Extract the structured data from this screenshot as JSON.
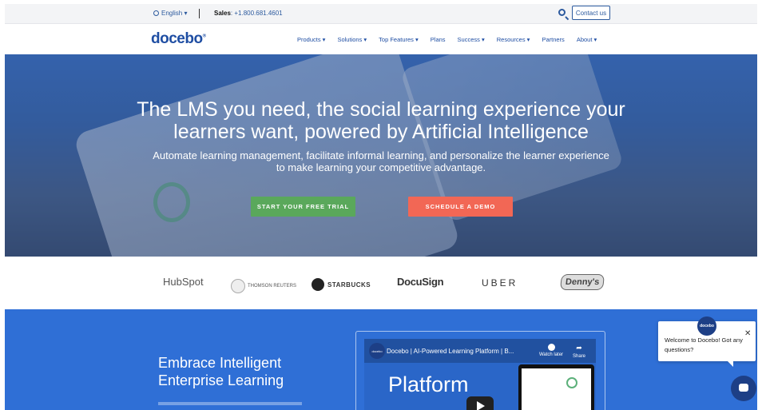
{
  "topbar": {
    "language": "English ▾",
    "sales_label": "Sales",
    "sales_phone": ": +1.800.681.4601",
    "contact_label": "Contact us"
  },
  "nav": {
    "logo": "docebo",
    "items": [
      {
        "label": "Products ▾"
      },
      {
        "label": "Solutions ▾"
      },
      {
        "label": "Top Features ▾"
      },
      {
        "label": "Plans"
      },
      {
        "label": "Success ▾"
      },
      {
        "label": "Resources ▾"
      },
      {
        "label": "Partners"
      },
      {
        "label": "About ▾"
      }
    ]
  },
  "hero": {
    "title_line1": "The LMS you need, the social learning experience your",
    "title_line2": "learners want, powered by Artificial Intelligence",
    "subtitle_line1": "Automate learning management, facilitate informal learning, and personalize the learner experience",
    "subtitle_line2": "to make learning your competitive advantage.",
    "trial_button": "START YOUR FREE TRIAL",
    "demo_button": "SCHEDULE A DEMO"
  },
  "customers": {
    "hubspot": "HubSpot",
    "thomson": "THOMSON REUTERS",
    "starbucks": "STARBUCKS",
    "docusign": "DocuSign",
    "uber": "UBER",
    "dennys": "Denny's"
  },
  "section2": {
    "title_line1": "Embrace Intelligent",
    "title_line2": "Enterprise Learning"
  },
  "video": {
    "channel": "docebo",
    "title": "Docebo | AI-Powered Learning Platform | B...",
    "watch_later": "Watch later",
    "share": "Share",
    "overlay_text": "Platform"
  },
  "chat": {
    "avatar_text": "docebo",
    "message": "Welcome to Docebo! Got any questions?",
    "close": "✕"
  }
}
